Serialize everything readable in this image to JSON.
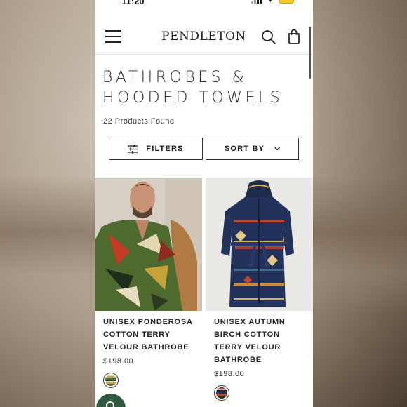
{
  "status_bar": {
    "time": "11:20"
  },
  "header": {
    "logo": "PENDLETON"
  },
  "page": {
    "title_line1": "BATHROBES &",
    "title_line2": "HOODED TOWELS",
    "count": "22 Products Found"
  },
  "controls": {
    "filters_label": "FILTERS",
    "sort_label": "SORT BY"
  },
  "products": [
    {
      "name": "UNISEX PONDEROSA COTTON TERRY VELOUR BATHROBE",
      "price": "$198.00"
    },
    {
      "name": "UNISEX AUTUMN BIRCH COTTON TERRY VELOUR BATHROBE",
      "price": "$198.00"
    }
  ],
  "colors": {
    "battery": "#f3c62a",
    "chat_button": "#2f5a40"
  }
}
